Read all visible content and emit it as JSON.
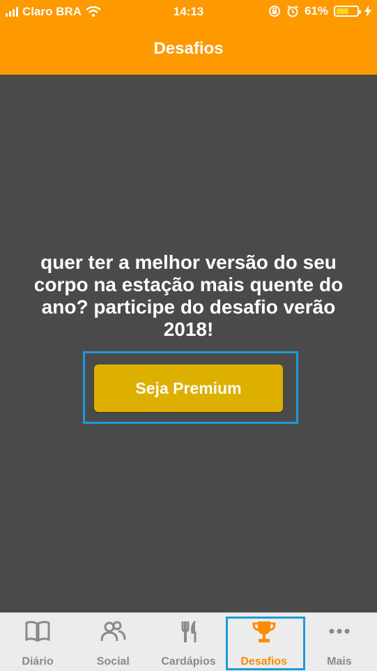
{
  "status_bar": {
    "carrier": "Claro BRA",
    "time": "14:13",
    "battery_percent": "61%",
    "battery_level": 0.61
  },
  "header": {
    "title": "Desafios",
    "background_color": "#ff9900"
  },
  "main": {
    "message": "quer ter a melhor versão do seu corpo na estação mais quente do ano? participe do desafio verão 2018!",
    "premium_button_label": "Seja Premium",
    "button_color": "#ddb000",
    "background_color": "#4a4a4a"
  },
  "tab_bar": {
    "active_color": "#ff8c00",
    "items": [
      {
        "label": "Diário",
        "icon": "book-icon"
      },
      {
        "label": "Social",
        "icon": "people-icon"
      },
      {
        "label": "Cardápios",
        "icon": "fork-knife-icon"
      },
      {
        "label": "Desafios",
        "icon": "trophy-icon",
        "active": true
      },
      {
        "label": "Mais",
        "icon": "more-dots-icon"
      }
    ]
  }
}
